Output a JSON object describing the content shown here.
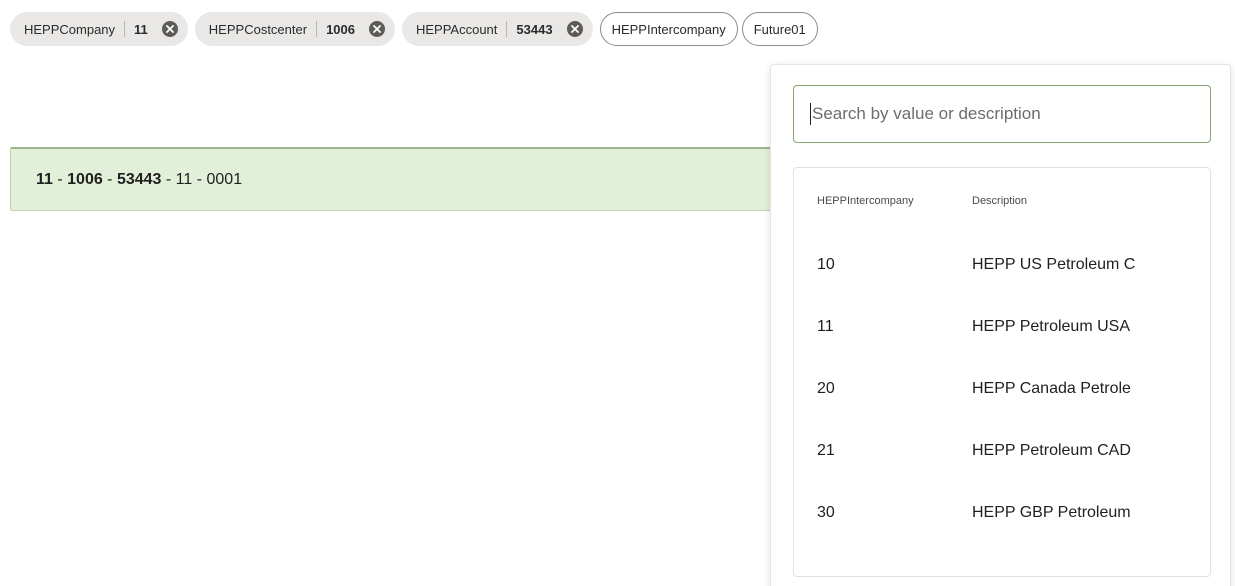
{
  "chips": [
    {
      "label": "HEPPCompany",
      "value": "11",
      "clear_icon": "circle-x-icon"
    },
    {
      "label": "HEPPCostcenter",
      "value": "1006",
      "clear_icon": "circle-x-icon"
    },
    {
      "label": "HEPPAccount",
      "value": "53443",
      "clear_icon": "circle-x-icon"
    }
  ],
  "outline_chips": [
    {
      "label": "HEPPIntercompany"
    },
    {
      "label": "Future01"
    }
  ],
  "combination": {
    "company": "11",
    "dash1": " - ",
    "costcenter": "1006",
    "dash2": " - ",
    "account": "53443",
    "rest": " - 11 - 0001"
  },
  "dropdown": {
    "search_placeholder": "Search by value or description",
    "search_value": "",
    "columns": [
      "HEPPIntercompany",
      "Description"
    ],
    "rows": [
      {
        "value": "10",
        "description": "HEPP US Petroleum C"
      },
      {
        "value": "11",
        "description": "HEPP Petroleum USA"
      },
      {
        "value": "20",
        "description": "HEPP Canada Petrole"
      },
      {
        "value": "21",
        "description": "HEPP Petroleum CAD"
      },
      {
        "value": "30",
        "description": "HEPP GBP Petroleum"
      }
    ]
  },
  "colors": {
    "chip_bg": "#e9e8e6",
    "combination_bg": "#e2f0d9",
    "search_border": "#84a56f"
  }
}
